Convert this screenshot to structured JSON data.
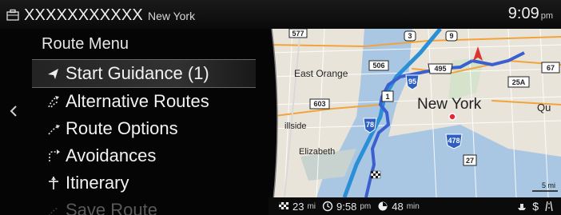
{
  "status": {
    "title": "XXXXXXXXXXX",
    "city": "New York",
    "time": "9:09",
    "ampm": "pm"
  },
  "menu": {
    "title": "Route Menu",
    "items": [
      {
        "label": "Start Guidance (1)",
        "icon": "guidance-arrow-icon",
        "state": "selected"
      },
      {
        "label": "Alternative Routes",
        "icon": "alt-routes-icon",
        "state": "normal"
      },
      {
        "label": "Route Options",
        "icon": "route-options-icon",
        "state": "normal"
      },
      {
        "label": "Avoidances",
        "icon": "avoid-icon",
        "state": "normal"
      },
      {
        "label": "Itinerary",
        "icon": "itinerary-icon",
        "state": "normal"
      },
      {
        "label": "Save Route",
        "icon": "save-route-icon",
        "state": "disabled"
      }
    ]
  },
  "map": {
    "labels": {
      "east_orange": "East Orange",
      "new_york": "New York",
      "hillside": "illside",
      "elizabeth": "Elizabeth",
      "qu": "Qu",
      "shield_577": "577",
      "shield_3": "3",
      "shield_9": "9",
      "shield_506": "506",
      "shield_495": "495",
      "shield_95": "95",
      "shield_67": "67",
      "shield_25a": "25A",
      "shield_603": "603",
      "shield_1": "1",
      "shield_78": "78",
      "shield_478": "478",
      "shield_27": "27"
    },
    "scale_label": "5 mi",
    "colors": {
      "route": "#3a5fcf",
      "highway": "#2b8fd6",
      "water": "#a9c6e3",
      "land": "#e9e4da"
    }
  },
  "info": {
    "distance": "23",
    "distance_unit": "mi",
    "arrival_time": "9:58",
    "arrival_ampm": "pm",
    "duration": "48",
    "duration_unit": "min"
  }
}
